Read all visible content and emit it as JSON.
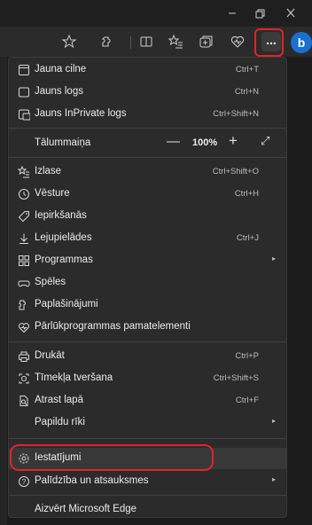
{
  "window": {
    "minimize_icon": "minimize-icon",
    "maximize_icon": "maximize-icon",
    "close_icon": "close-icon"
  },
  "toolbar": {
    "icons": [
      "favorite-star-icon",
      "extensions-icon",
      "split-screen-icon",
      "favorites-icon",
      "collections-icon",
      "browser-essentials-icon"
    ],
    "more_label": "...",
    "bing_label": "b"
  },
  "menu": {
    "items": [
      {
        "label": "Jauna cilne",
        "shortcut": "Ctrl+T"
      },
      {
        "label": "Jauns logs",
        "shortcut": "Ctrl+N"
      },
      {
        "label": "Jauns InPrivate logs",
        "shortcut": "Ctrl+Shift+N"
      }
    ],
    "zoom": {
      "label": "Tālummaiņa",
      "minus": "—",
      "value": "100%",
      "plus": "+",
      "fullscreen": "⤢"
    },
    "items2": [
      {
        "label": "Izlase",
        "shortcut": "Ctrl+Shift+O"
      },
      {
        "label": "Vēsture",
        "shortcut": "Ctrl+H"
      },
      {
        "label": "Iepirkšanās",
        "shortcut": ""
      },
      {
        "label": "Lejupielādes",
        "shortcut": "Ctrl+J"
      },
      {
        "label": "Programmas",
        "shortcut": "",
        "submenu": "▸"
      },
      {
        "label": "Spēles",
        "shortcut": ""
      },
      {
        "label": "Paplašinājumi",
        "shortcut": ""
      },
      {
        "label": "Pārlūkprogrammas pamatelementi",
        "shortcut": ""
      }
    ],
    "items3": [
      {
        "label": "Drukāt",
        "shortcut": "Ctrl+P"
      },
      {
        "label": "Tīmekļa tveršana",
        "shortcut": "Ctrl+Shift+S"
      },
      {
        "label": "Atrast lapā",
        "shortcut": "Ctrl+F"
      },
      {
        "label": "Papildu rīki",
        "shortcut": "",
        "submenu": "▸"
      }
    ],
    "items4": [
      {
        "label": "Iestatījumi",
        "shortcut": ""
      },
      {
        "label": "Palīdzība un atsauksmes",
        "shortcut": "",
        "submenu": "▸"
      }
    ],
    "close_label": "Aizvērt Microsoft Edge"
  },
  "colors": {
    "highlight": "#e0242a",
    "bing": "#1a6fd0",
    "menu_bg": "#2b2b2b"
  }
}
